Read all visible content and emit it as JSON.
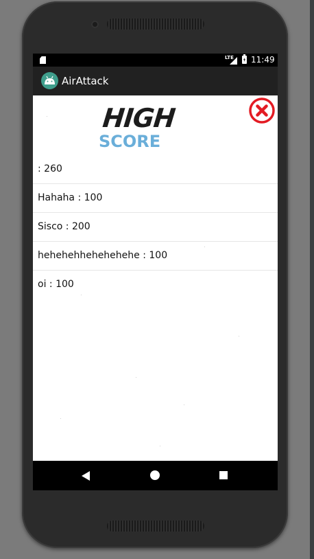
{
  "status_bar": {
    "network_label": "LTE",
    "time": "11:49"
  },
  "app_bar": {
    "title": "AirAttack",
    "icon": "android-icon"
  },
  "header": {
    "logo_line1": "HIGH",
    "logo_line2": "SCORE",
    "close_icon": "close-icon"
  },
  "scores": [
    " : 260",
    "Hahaha : 100",
    "Sisco : 200",
    "hehehehhehehehehe : 100",
    "oi : 100"
  ],
  "nav_bar": {
    "back_icon": "back-icon",
    "home_icon": "home-icon",
    "recents_icon": "recents-icon"
  },
  "colors": {
    "app_bar": "#212121",
    "close_red": "#e31b23",
    "score_blue": "#6aaed9"
  }
}
